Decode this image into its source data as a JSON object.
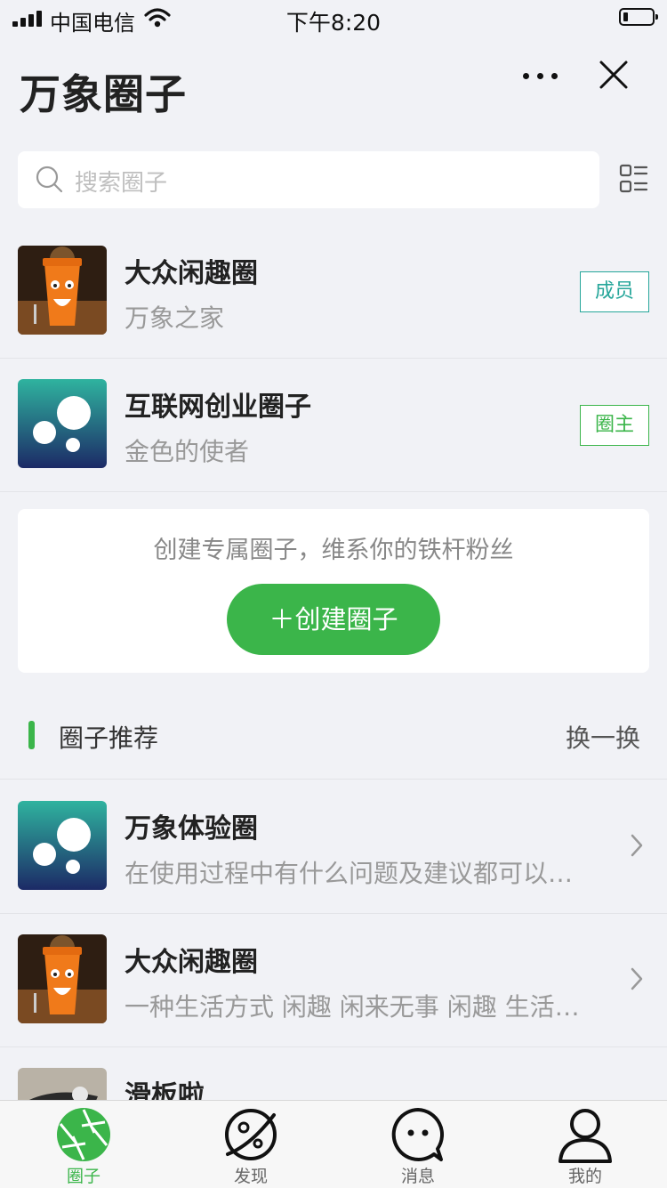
{
  "status_bar": {
    "carrier": "中国电信",
    "time": "下午8:20"
  },
  "header": {
    "title": "万象圈子"
  },
  "search": {
    "placeholder": "搜索圈子"
  },
  "my_circles": [
    {
      "name": "大众闲趣圈",
      "owner": "万象之家",
      "role": "成员",
      "role_color": "#26a69a",
      "thumb": "coffee-cup-image"
    },
    {
      "name": "互联网创业圈子",
      "owner": "金色的使者",
      "role": "圈主",
      "role_color": "#3bb54a",
      "thumb": "bubbles-logo"
    }
  ],
  "create_card": {
    "tip": "创建专属圈子，维系你的铁杆粉丝",
    "button_label": "＋创建圈子"
  },
  "recommend": {
    "title": "圈子推荐",
    "refresh_label": "换一换",
    "items": [
      {
        "name": "万象体验圈",
        "desc": "在使用过程中有什么问题及建议都可以…",
        "thumb": "bubbles-logo"
      },
      {
        "name": "大众闲趣圈",
        "desc": "一种生活方式 闲趣 闲来无事 闲趣 生活…",
        "thumb": "coffee-cup-image"
      },
      {
        "name": "滑板啦",
        "desc": "",
        "thumb": "skateboard-photo"
      }
    ]
  },
  "tabs": [
    {
      "label": "圈子",
      "icon": "aperture-icon",
      "active": true
    },
    {
      "label": "发现",
      "icon": "planet-icon",
      "active": false
    },
    {
      "label": "消息",
      "icon": "chat-bubble-icon",
      "active": false
    },
    {
      "label": "我的",
      "icon": "person-icon",
      "active": false
    }
  ],
  "colors": {
    "accent": "#3bb54a",
    "background": "#f1f2f6",
    "teal_badge": "#26a69a"
  }
}
